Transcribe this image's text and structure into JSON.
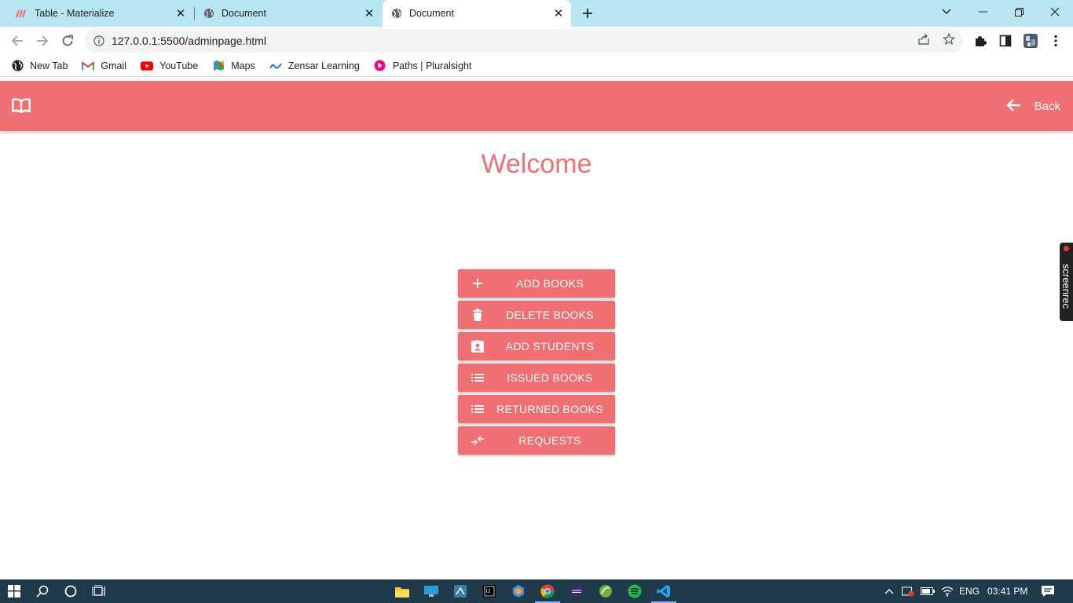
{
  "browser": {
    "tabs": [
      {
        "title": "Table - Materialize",
        "active": false
      },
      {
        "title": "Document",
        "active": false
      },
      {
        "title": "Document",
        "active": true
      }
    ],
    "url": "127.0.0.1:5500/adminpage.html",
    "bookmarks": [
      "New Tab",
      "Gmail",
      "YouTube",
      "Maps",
      "Zensar Learning",
      "Paths | Pluralsight"
    ]
  },
  "app": {
    "back_label": "Back",
    "welcome": "Welcome",
    "accent_color": "#ef6f73",
    "buttons": [
      {
        "label": "ADD BOOKS",
        "icon": "plus-icon"
      },
      {
        "label": "DELETE BOOKS",
        "icon": "trash-icon"
      },
      {
        "label": "ADD STUDENTS",
        "icon": "contact-card-icon"
      },
      {
        "label": "ISSUED BOOKS",
        "icon": "list-icon"
      },
      {
        "label": "RETURNED BOOKS",
        "icon": "list-icon"
      },
      {
        "label": "REQUESTS",
        "icon": "compare-arrows-icon"
      }
    ]
  },
  "overlay": {
    "screenrec_label": "screenrec"
  },
  "taskbar": {
    "language": "ENG",
    "time": "03:41 PM"
  }
}
